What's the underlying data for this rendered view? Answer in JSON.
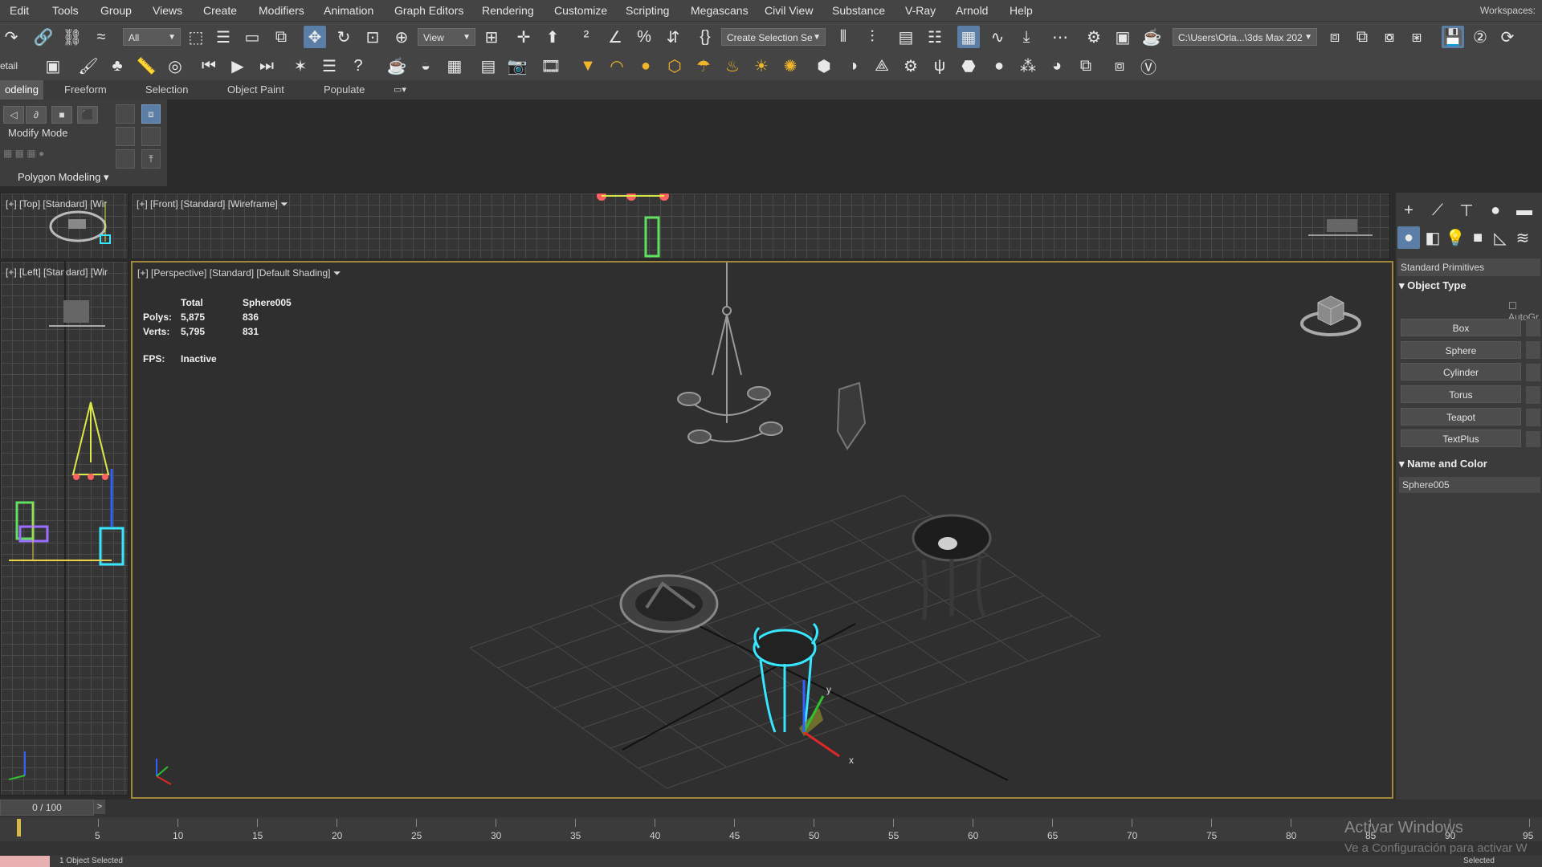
{
  "menu": [
    "Edit",
    "Tools",
    "Group",
    "Views",
    "Create",
    "Modifiers",
    "Animation",
    "Graph Editors",
    "Rendering",
    "Customize",
    "Scripting",
    "Megascans",
    "Civil View",
    "Substance",
    "V-Ray",
    "Arnold",
    "Help"
  ],
  "workspaces_label": "Workspaces:",
  "toolbar": {
    "filter_value": "All",
    "view_value": "View",
    "selection_set_value": "Create Selection Se",
    "path_value": "C:\\Users\\Orla...\\3ds Max 202"
  },
  "toolbar2_left_label": "etail",
  "ribbon": {
    "tabs": [
      "odeling",
      "Freeform",
      "Selection",
      "Object Paint",
      "Populate"
    ],
    "modify_mode": "Modify Mode",
    "polygon_modeling": "Polygon Modeling"
  },
  "viewports": {
    "top": "[+] [Top] [Standard] [Wir",
    "front": "[+] [Front] [Standard] [Wireframe]",
    "left": "[+] [Left] [Standard] [Wir",
    "perspective": "[+] [Perspective] [Standard] [Default Shading]"
  },
  "stats": {
    "total_header": "Total",
    "object_header": "Sphere005",
    "polys_label": "Polys:",
    "polys_total": "5,875",
    "polys_object": "836",
    "verts_label": "Verts:",
    "verts_total": "5,795",
    "verts_object": "831",
    "fps_label": "FPS:",
    "fps_value": "Inactive"
  },
  "command_panel": {
    "category": "Standard Primitives",
    "object_type_title": "Object Type",
    "autogrid": "AutoGr",
    "buttons": [
      "Box",
      "Sphere",
      "Cylinder",
      "Torus",
      "Teapot",
      "TextPlus"
    ],
    "name_color_title": "Name and Color",
    "object_name": "Sphere005"
  },
  "timeline": {
    "frame_display": "0 / 100",
    "ticks": [
      "5",
      "10",
      "15",
      "20",
      "25",
      "30",
      "35",
      "40",
      "45",
      "50",
      "55",
      "60",
      "65",
      "70",
      "75",
      "80",
      "85",
      "90",
      "95"
    ]
  },
  "status": {
    "selected": "1 Object Selected",
    "selected_dropdown": "Selected"
  },
  "watermark": {
    "line1": "Activar Windows",
    "line2": "Ve a Configuración para activar W"
  },
  "colors": {
    "selection_cyan": "#37e6ff",
    "viewport_border": "#a08a3a",
    "active_blue": "#5b7ea6"
  }
}
